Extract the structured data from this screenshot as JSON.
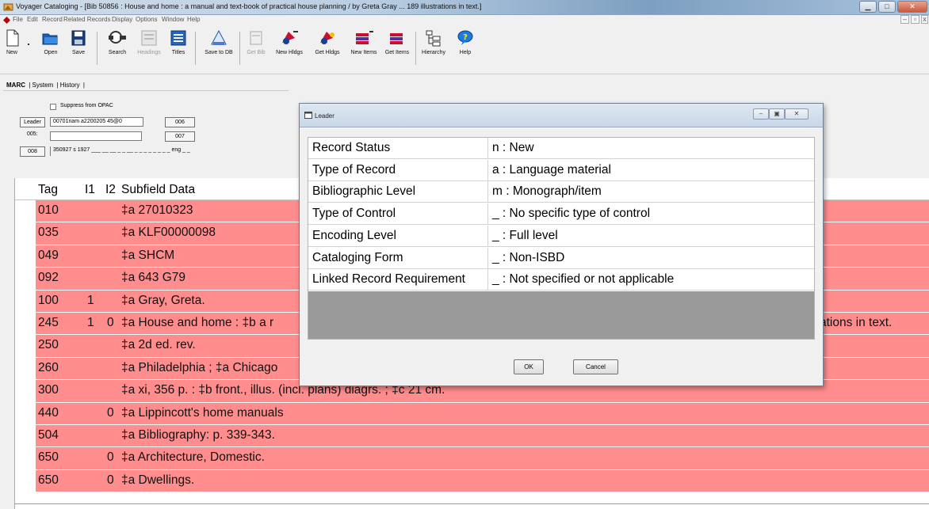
{
  "window": {
    "title": "Voyager Cataloging - [Bib 50856 : House and home : a manual and text-book of practical house planning / by Greta Gray ... 189 illustrations in text.]",
    "controls": [
      "minimize",
      "maximize",
      "close"
    ]
  },
  "menu": {
    "items": [
      "File",
      "Edit",
      "Record",
      "Related Records",
      "Display",
      "Options",
      "Window",
      "Help"
    ]
  },
  "toolbar": {
    "buttons": [
      {
        "label": "New",
        "icon": "new-document-icon",
        "enabled": true
      },
      {
        "label": "Open",
        "icon": "open-folder-icon",
        "enabled": true
      },
      {
        "label": "Save",
        "icon": "save-disk-icon",
        "enabled": true
      },
      {
        "label": "Search",
        "icon": "search-icon",
        "enabled": true
      },
      {
        "label": "Headings",
        "icon": "headings-icon",
        "enabled": false
      },
      {
        "label": "Titles",
        "icon": "titles-icon",
        "enabled": true
      },
      {
        "label": "Save to DB",
        "icon": "save-to-db-icon",
        "enabled": true
      },
      {
        "label": "Get Bib",
        "icon": "get-bib-icon",
        "enabled": false
      },
      {
        "label": "New Hldgs",
        "icon": "new-holdings-icon",
        "enabled": true
      },
      {
        "label": "Get Hldgs",
        "icon": "get-holdings-icon",
        "enabled": true
      },
      {
        "label": "New Items",
        "icon": "new-items-icon",
        "enabled": true
      },
      {
        "label": "Get Items",
        "icon": "get-items-icon",
        "enabled": true
      },
      {
        "label": "Hierarchy",
        "icon": "hierarchy-icon",
        "enabled": true
      },
      {
        "label": "Help",
        "icon": "help-icon",
        "enabled": true
      }
    ]
  },
  "record_tabs": [
    "MARC",
    "System",
    "History"
  ],
  "record_header": {
    "suppress_label": "Suppress from OPAC",
    "leader_button": "Leader",
    "leader_value": "00701nam a2200205 45@0",
    "btn_006": "006",
    "label_005": "005:",
    "value_005": "",
    "btn_007": "007",
    "btn_008": "008",
    "value_008": "350927 s 1927 ___ __ __ _ _ __ _ _ _ _ _ _ _ _ eng _ _"
  },
  "grid": {
    "headers": [
      "Tag",
      "I1",
      "I2",
      "Subfield Data"
    ],
    "rows": [
      {
        "tag": "010",
        "i1": "",
        "i2": "",
        "data": "‡a   27010323"
      },
      {
        "tag": "035",
        "i1": "",
        "i2": "",
        "data": "‡a KLF00000098"
      },
      {
        "tag": "049",
        "i1": "",
        "i2": "",
        "data": "‡a SHCM"
      },
      {
        "tag": "092",
        "i1": "",
        "i2": "",
        "data": "‡a 643 G79"
      },
      {
        "tag": "100",
        "i1": "1",
        "i2": "",
        "data": "‡a Gray, Greta."
      },
      {
        "tag": "245",
        "i1": "1",
        "i2": "0",
        "data": "‡a House and home : ‡b a r",
        "tail": "ations in text."
      },
      {
        "tag": "250",
        "i1": "",
        "i2": "",
        "data": "‡a 2d ed. rev."
      },
      {
        "tag": "260",
        "i1": "",
        "i2": "",
        "data": "‡a Philadelphia ; ‡a Chicago"
      },
      {
        "tag": "300",
        "i1": "",
        "i2": "",
        "data": "‡a xi, 356 p. : ‡b front., illus. (incl. plans) diagrs. ; ‡c 21 cm."
      },
      {
        "tag": "440",
        "i1": "",
        "i2": "0",
        "data": "‡a Lippincott's home manuals"
      },
      {
        "tag": "504",
        "i1": "",
        "i2": "",
        "data": "‡a Bibliography: p. 339-343."
      },
      {
        "tag": "650",
        "i1": "",
        "i2": "0",
        "data": "‡a Architecture, Domestic."
      },
      {
        "tag": "650",
        "i1": "",
        "i2": "0",
        "data": "‡a Dwellings."
      }
    ],
    "row_color": "#ff8d8d"
  },
  "dialog": {
    "title": "Leader",
    "rows": [
      {
        "label": "Record Status",
        "value": "n : New"
      },
      {
        "label": "Type of Record",
        "value": "a : Language material"
      },
      {
        "label": "Bibliographic Level",
        "value": "m : Monograph/item"
      },
      {
        "label": "Type of Control",
        "value": "_ : No specific type of control"
      },
      {
        "label": "Encoding Level",
        "value": "_ : Full level"
      },
      {
        "label": "Cataloging Form",
        "value": "_ : Non-ISBD"
      },
      {
        "label": "Linked Record Requirement",
        "value": "_ : Not specified or not applicable"
      }
    ],
    "ok_label": "OK",
    "cancel_label": "Cancel"
  }
}
